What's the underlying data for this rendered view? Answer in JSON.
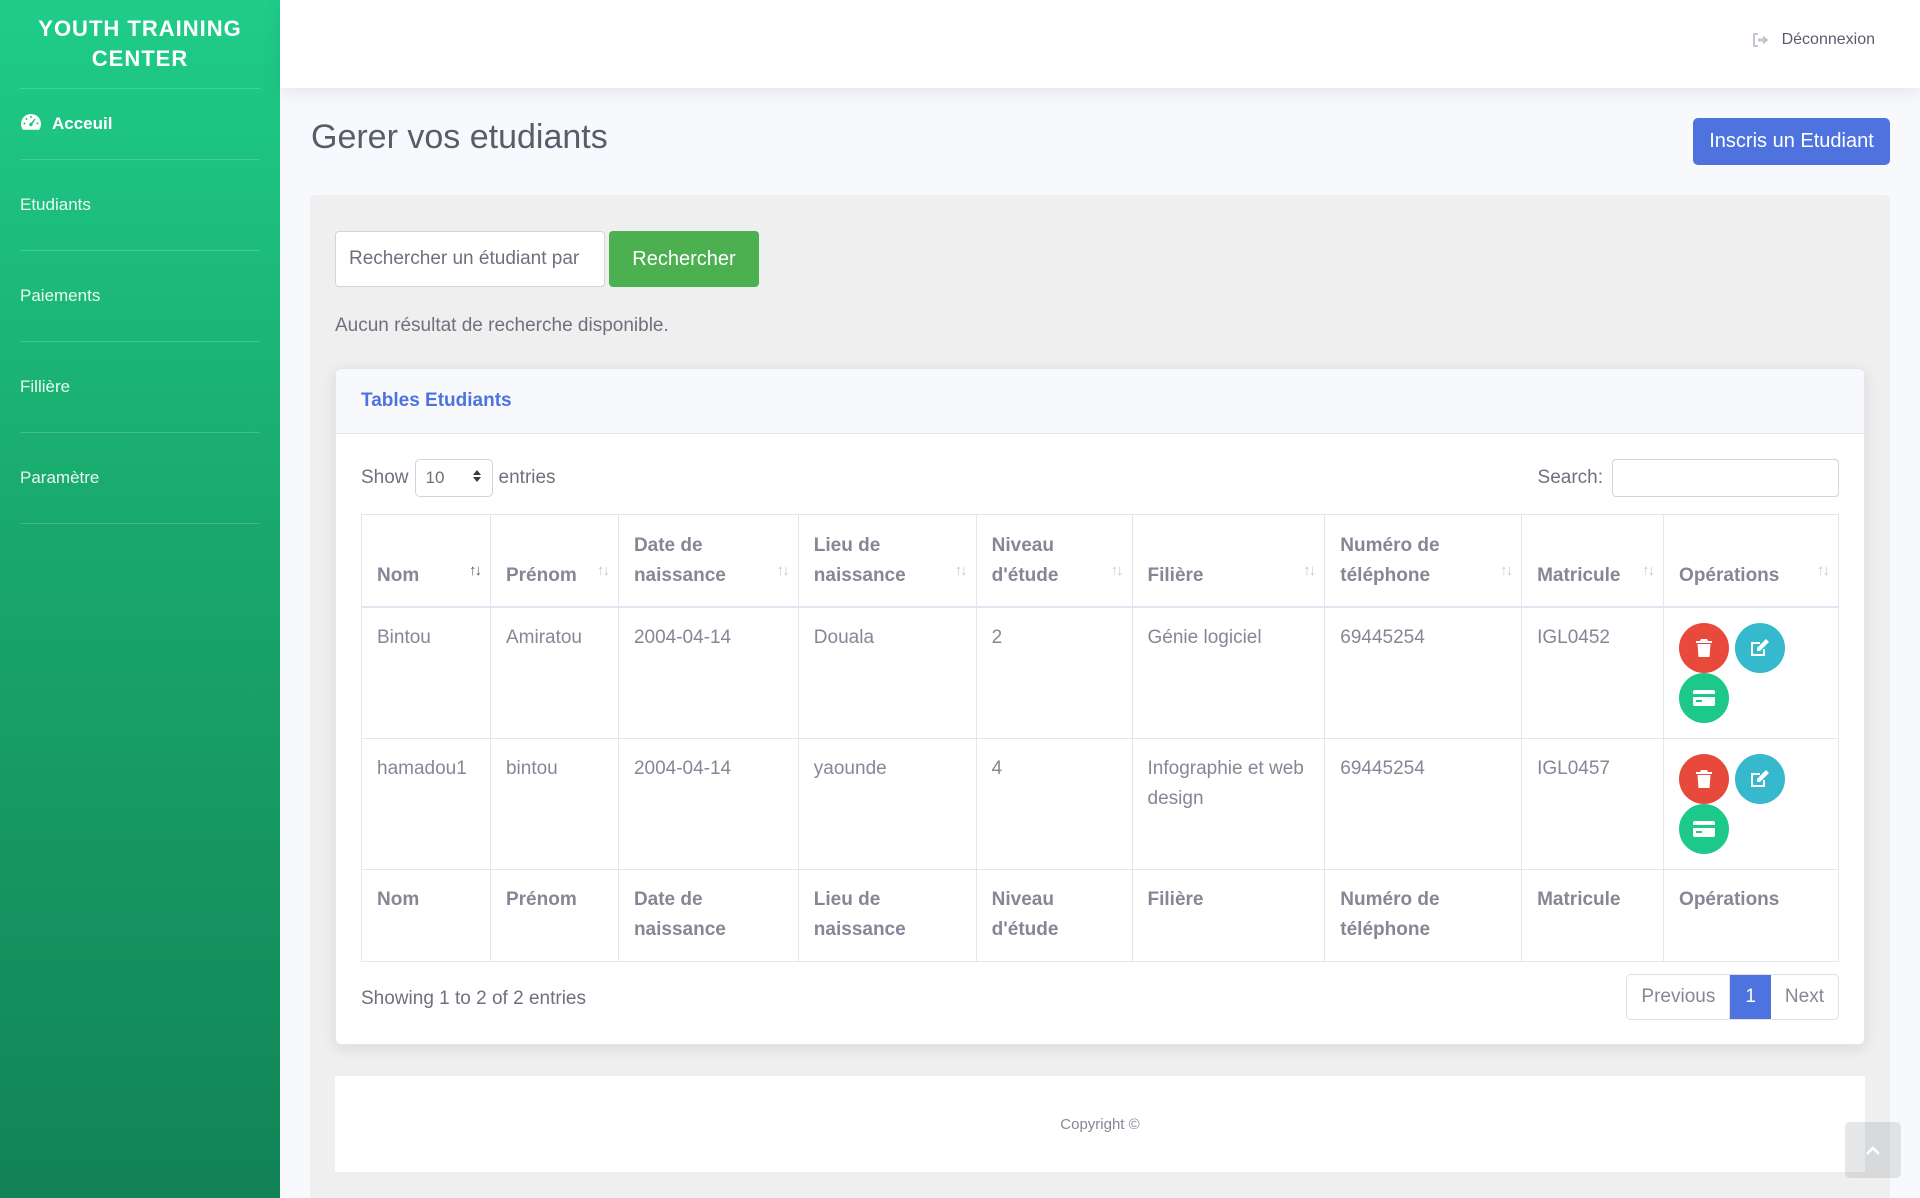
{
  "sidebar": {
    "brand": "YOUTH TRAINING CENTER",
    "items": [
      {
        "label": "Acceuil",
        "icon": "dashboard-icon"
      },
      {
        "label": "Etudiants"
      },
      {
        "label": "Paiements"
      },
      {
        "label": "Fillière"
      },
      {
        "label": "Paramètre"
      }
    ]
  },
  "topbar": {
    "logout_label": "Déconnexion",
    "logout_icon": "sign-out-icon"
  },
  "page": {
    "title": "Gerer vos etudiants",
    "add_button": "Inscris un Etudiant"
  },
  "search": {
    "placeholder": "Rechercher un étudiant par",
    "button": "Rechercher",
    "no_result": "Aucun résultat de recherche disponible."
  },
  "card": {
    "title": "Tables Etudiants",
    "show_label": "Show",
    "entries_value": "10",
    "entries_label": "entries",
    "search_label": "Search:"
  },
  "table": {
    "headers": {
      "nom": "Nom",
      "prenom": "Prénom",
      "date_1": "Date de",
      "date_2": "naissance",
      "lieu_1": "Lieu de",
      "lieu_2": "naissance",
      "niveau_1": "Niveau",
      "niveau_2": "d'étude",
      "filiere": "Filière",
      "tel_1": "Numéro de",
      "tel_2": "téléphone",
      "matricule": "Matricule",
      "operations": "Opérations"
    },
    "rows": [
      {
        "nom": "Bintou",
        "prenom": "Amiratou",
        "date": "2004-04-14",
        "lieu": "Douala",
        "niveau": "2",
        "filiere": "Génie logiciel",
        "tel": "69445254",
        "matricule": "IGL0452"
      },
      {
        "nom": "hamadou1",
        "prenom": "bintou",
        "date": "2004-04-14",
        "lieu": "yaounde",
        "niveau": "4",
        "filiere": "Infographie et web design",
        "tel": "69445254",
        "matricule": "IGL0457"
      }
    ]
  },
  "pagination": {
    "info": "Showing 1 to 2 of 2 entries",
    "previous": "Previous",
    "current": "1",
    "next": "Next"
  },
  "footer": {
    "copyright": "Copyright ©"
  },
  "colors": {
    "sidebar": "#1cc88a",
    "primary": "#4e73df",
    "success": "#4caf50",
    "danger": "#e74a3b",
    "info": "#36b9cc"
  }
}
